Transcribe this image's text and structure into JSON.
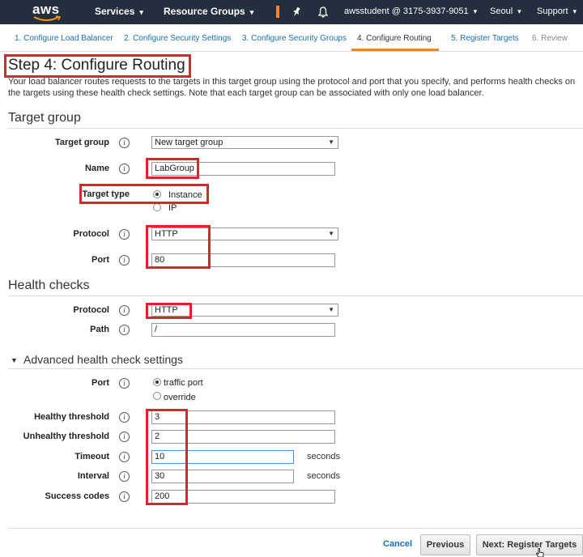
{
  "topnav": {
    "logo": "aws",
    "services": "Services",
    "resource_groups": "Resource Groups",
    "account": "awsstudent @ 3175-3937-9051",
    "region": "Seoul",
    "support": "Support"
  },
  "tabs": [
    {
      "label": "1. Configure Load Balancer"
    },
    {
      "label": "2. Configure Security Settings"
    },
    {
      "label": "3. Configure Security Groups"
    },
    {
      "label": "4. Configure Routing"
    },
    {
      "label": "5. Register Targets"
    },
    {
      "label": "6. Review"
    }
  ],
  "page": {
    "title": "Step 4: Configure Routing",
    "description": "Your load balancer routes requests to the targets in this target group using the protocol and port that you specify, and performs health checks on the targets using these health check settings. Note that each target group can be associated with only one load balancer."
  },
  "target_group": {
    "heading": "Target group",
    "target_group_label": "Target group",
    "target_group_value": "New target group",
    "name_label": "Name",
    "name_value": "LabGroup",
    "target_type_label": "Target type",
    "target_type_options": [
      "Instance",
      "IP"
    ],
    "protocol_label": "Protocol",
    "protocol_value": "HTTP",
    "port_label": "Port",
    "port_value": "80"
  },
  "health_checks": {
    "heading": "Health checks",
    "protocol_label": "Protocol",
    "protocol_value": "HTTP",
    "path_label": "Path",
    "path_value": "/"
  },
  "advanced": {
    "heading": "Advanced health check settings",
    "port_label": "Port",
    "port_options": [
      "traffic port",
      "override"
    ],
    "healthy_label": "Healthy threshold",
    "healthy_value": "3",
    "unhealthy_label": "Unhealthy threshold",
    "unhealthy_value": "2",
    "timeout_label": "Timeout",
    "timeout_value": "10",
    "interval_label": "Interval",
    "interval_value": "30",
    "success_label": "Success codes",
    "success_value": "200",
    "seconds": "seconds"
  },
  "footer": {
    "cancel": "Cancel",
    "previous": "Previous",
    "next": "Next: Register Targets"
  },
  "colors": {
    "nav_bg": "#232f3e",
    "accent_orange": "#e4892c",
    "link_blue": "#1a6fb0",
    "highlight_red": "#e4202a"
  }
}
